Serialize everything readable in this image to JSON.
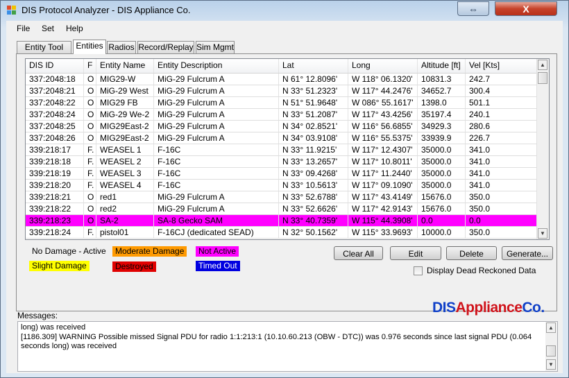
{
  "window": {
    "title": "DIS Protocol Analyzer - DIS Appliance Co.",
    "close_glyph": "X",
    "restore_glyph": "⇔"
  },
  "menu": [
    "File",
    "Set",
    "Help"
  ],
  "tabs": [
    {
      "label": "Entity Tool Info",
      "active": false
    },
    {
      "label": "Entities",
      "active": true
    },
    {
      "label": "Radios",
      "active": false
    },
    {
      "label": "Record/Replay",
      "active": false
    },
    {
      "label": "Sim Mgmt",
      "active": false
    }
  ],
  "grid": {
    "columns": [
      "DIS ID",
      "F",
      "Entity Name",
      "Entity Description",
      "Lat",
      "Long",
      "Altitude [ft]",
      "Vel [Kts]"
    ],
    "rows": [
      {
        "status": "none",
        "cells": [
          "337:2048:18",
          "O",
          "MIG29-W",
          "MiG-29 Fulcrum A",
          "N 61° 12.8096'",
          "W 118° 06.1320'",
          "10831.3",
          "242.7"
        ]
      },
      {
        "status": "none",
        "cells": [
          "337:2048:21",
          "O",
          "MiG-29 West",
          "MiG-29 Fulcrum A",
          "N 33° 51.2323'",
          "W 117° 44.2476'",
          "34652.7",
          "300.4"
        ]
      },
      {
        "status": "none",
        "cells": [
          "337:2048:22",
          "O",
          "MIG29 FB",
          "MiG-29 Fulcrum A",
          "N 51° 51.9648'",
          "W 086° 55.1617'",
          "1398.0",
          "501.1"
        ]
      },
      {
        "status": "none",
        "cells": [
          "337:2048:24",
          "O",
          "MiG-29 We-2",
          "MiG-29 Fulcrum A",
          "N 33° 51.2087'",
          "W 117° 43.4256'",
          "35197.4",
          "240.1"
        ]
      },
      {
        "status": "none",
        "cells": [
          "337:2048:25",
          "O",
          "MIG29East-2",
          "MiG-29 Fulcrum A",
          "N 34° 02.8521'",
          "W 116° 56.6855'",
          "34929.3",
          "280.6"
        ]
      },
      {
        "status": "none",
        "cells": [
          "337:2048:26",
          "O",
          "MIG29East-2",
          "MiG-29 Fulcrum A",
          "N 34° 03.9108'",
          "W 116° 55.5375'",
          "33939.9",
          "226.7"
        ]
      },
      {
        "status": "none",
        "cells": [
          "339:218:17",
          "F.",
          "WEASEL 1",
          "F-16C",
          "N 33° 11.9215'",
          "W 117° 12.4307'",
          "35000.0",
          "341.0"
        ]
      },
      {
        "status": "none",
        "cells": [
          "339:218:18",
          "F.",
          "WEASEL 2",
          "F-16C",
          "N 33° 13.2657'",
          "W 117° 10.8011'",
          "35000.0",
          "341.0"
        ]
      },
      {
        "status": "none",
        "cells": [
          "339:218:19",
          "F.",
          "WEASEL 3",
          "F-16C",
          "N 33° 09.4268'",
          "W 117° 11.2440'",
          "35000.0",
          "341.0"
        ]
      },
      {
        "status": "none",
        "cells": [
          "339:218:20",
          "F.",
          "WEASEL 4",
          "F-16C",
          "N 33° 10.5613'",
          "W 117° 09.1090'",
          "35000.0",
          "341.0"
        ]
      },
      {
        "status": "none",
        "cells": [
          "339:218:21",
          "O",
          "red1",
          "MiG-29 Fulcrum A",
          "N 33° 52.6788'",
          "W 117° 43.4149'",
          "15676.0",
          "350.0"
        ]
      },
      {
        "status": "none",
        "cells": [
          "339:218:22",
          "O",
          "red2",
          "MiG-29 Fulcrum A",
          "N 33° 52.6626'",
          "W 117° 42.9143'",
          "15676.0",
          "350.0"
        ]
      },
      {
        "status": "notactive",
        "cells": [
          "339:218:23",
          "O",
          "SA-2",
          "SA-8 Gecko SAM",
          "N 33° 40.7359'",
          "W 115° 44.3908'",
          "0.0",
          "0.0"
        ]
      },
      {
        "status": "none",
        "cells": [
          "339:218:24",
          "F.",
          "pistol01",
          "F-16CJ (dedicated SEAD)",
          "N 32° 50.1562'",
          "W 115° 33.9693'",
          "10000.0",
          "350.0"
        ]
      }
    ]
  },
  "legend": [
    {
      "label": "No Damage - Active",
      "bg": "#f0f0f0",
      "fg": "#000000"
    },
    {
      "label": "Moderate Damage",
      "bg": "#ff9a00",
      "fg": "#000000"
    },
    {
      "label": "Not Active",
      "bg": "#ff00ff",
      "fg": "#000000"
    },
    {
      "label": "Slight Damage",
      "bg": "#ffff00",
      "fg": "#000000"
    },
    {
      "label": "Destroyed",
      "bg": "#e00000",
      "fg": "#000000"
    },
    {
      "label": "Timed Out",
      "bg": "#0000e0",
      "fg": "#ffffff"
    }
  ],
  "buttons": {
    "clear_all": "Clear All",
    "edit": "Edit",
    "delete": "Delete",
    "generate": "Generate..."
  },
  "display_dead_reckoned": {
    "label": "Display Dead Reckoned Data",
    "checked": false
  },
  "logo": {
    "part1": "DIS",
    "part2": "Appliance",
    "part3": "Co."
  },
  "messages": {
    "label": "Messages:",
    "text": "long) was received\n[1186.309] WARNING Possible missed Signal PDU for radio 1:1:213:1 (10.10.60.213 (OBW - DTC)) was 0.976 seconds since last signal PDU (0.064 seconds long) was received"
  },
  "colors": {
    "not_active_row": "#ff00ff",
    "logo_blue": "#1040c8",
    "logo_red": "#d0131b"
  }
}
